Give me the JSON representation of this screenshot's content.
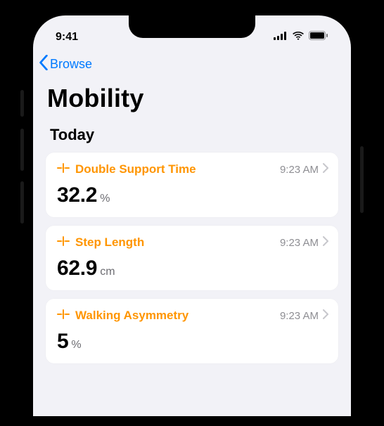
{
  "status": {
    "time": "9:41"
  },
  "nav": {
    "back_label": "Browse"
  },
  "title": "Mobility",
  "section": "Today",
  "cards": [
    {
      "label": "Double Support Time",
      "time": "9:23 AM",
      "value": "32.2",
      "unit": "%"
    },
    {
      "label": "Step Length",
      "time": "9:23 AM",
      "value": "62.9",
      "unit": "cm"
    },
    {
      "label": "Walking Asymmetry",
      "time": "9:23 AM",
      "value": "5",
      "unit": "%"
    }
  ]
}
